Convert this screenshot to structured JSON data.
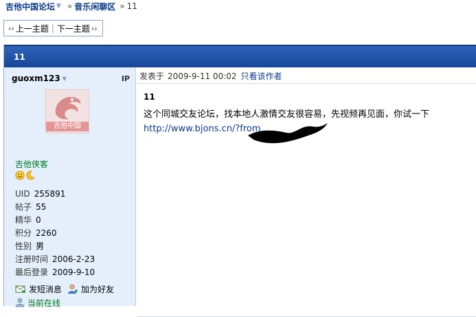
{
  "breadcrumb": {
    "forum": "吉他中国论坛",
    "section": "音乐闲聊区",
    "sep": "»",
    "current": "11"
  },
  "thread_nav": {
    "prev_quote": "‹‹",
    "prev": "上一主题",
    "divider": "|",
    "next": "下一主题",
    "next_quote": "››"
  },
  "post": {
    "header_title": "11",
    "meta_label": "发表于",
    "meta_time": "2009-9-11 00:02",
    "only_author": "只看该作者",
    "title": "11",
    "body": "这个同城交友论坛，找本地人激情交友很容易，先视频再见面，你试一下",
    "link": "http://www.bjons.cn/?from"
  },
  "author": {
    "name": "guoxm123",
    "ip_label": "IP",
    "avatar_text": "吉他中国",
    "title": "吉他侠客",
    "stats": [
      {
        "key": "UID",
        "value": "255891"
      },
      {
        "key": "帖子",
        "value": "55"
      },
      {
        "key": "精华",
        "value": "0"
      },
      {
        "key": "积分",
        "value": "2260"
      },
      {
        "key": "性别",
        "value": "男"
      },
      {
        "key": "注册时间",
        "value": "2006-2-23"
      },
      {
        "key": "最后登录",
        "value": "2009-9-10"
      }
    ],
    "actions": {
      "message": "发短消息",
      "add_friend": "加为好友",
      "online": "当前在线"
    }
  },
  "colors": {
    "header_blue": "#1e4fa6",
    "link_blue": "#0b3a8a",
    "sidebar_bg": "#e4effb",
    "online_green": "#007a1f"
  }
}
